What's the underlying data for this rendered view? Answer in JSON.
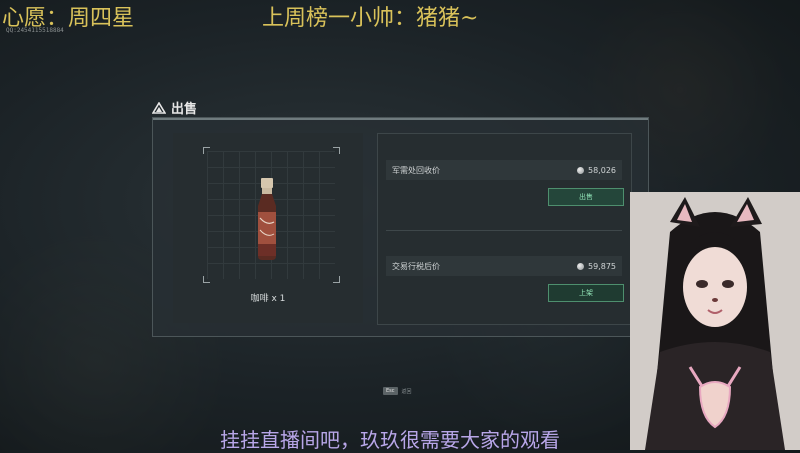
{
  "overlay": {
    "wish_text": "心愿：周四星",
    "rank_text": "上周榜一小帅：猪猪~",
    "caption": "挂挂直播间吧，玖玖很需要大家的观看",
    "tiny_id": "QQ:2454115518884"
  },
  "sell_panel": {
    "title": "出售",
    "item_name": "咖啡 x 1",
    "military_buyback": {
      "label": "军需处回收价",
      "value": "58,026",
      "button_label": "出售"
    },
    "post_tax_trade": {
      "label": "交易行税后价",
      "value": "59,875",
      "button_label": "上架"
    }
  },
  "hint": {
    "key": "Esc",
    "label": "返回"
  },
  "colors": {
    "overlay_yellow": "#d9c25a",
    "caption_purple": "#b8a6e8",
    "button_green": "#8fe0b4"
  }
}
